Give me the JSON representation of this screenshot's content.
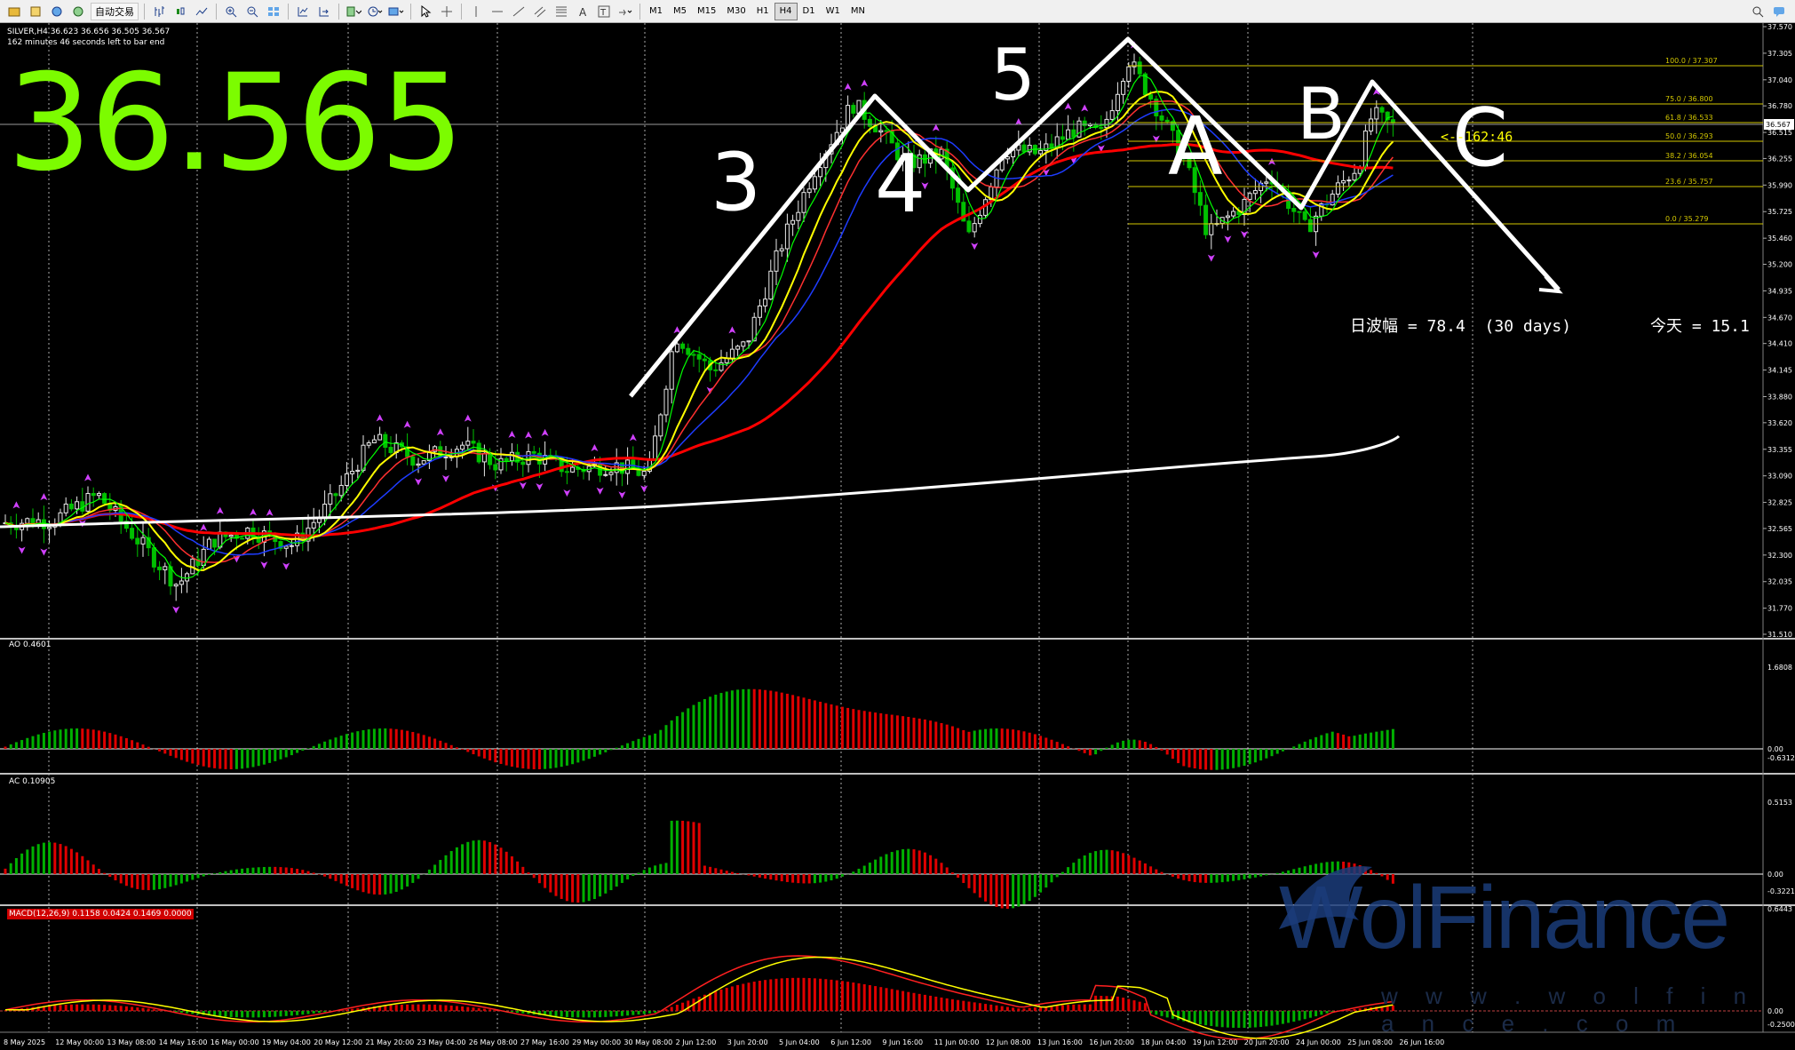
{
  "toolbar": {
    "auto_trade_label": "自动交易",
    "timeframes": [
      "M1",
      "M5",
      "M15",
      "M30",
      "H1",
      "H4",
      "D1",
      "W1",
      "MN"
    ],
    "active_timeframe": "H4"
  },
  "chart": {
    "symbol_info": "SILVER,H4 36.623 36.656 36.505 36.567",
    "bar_countdown": "162 minutes 46 seconds left to bar end",
    "big_price": "36.565",
    "timer_label": "<--162:46",
    "range_text": "日波幅 = 78.4  (30 days)",
    "today_text": "今天 = 15.1",
    "wave_labels": [
      "3",
      "4",
      "5",
      "A",
      "B",
      "C"
    ],
    "price_axis": [
      "37.570",
      "37.305",
      "37.040",
      "36.780",
      "36.515",
      "36.255",
      "35.990",
      "35.725",
      "35.460",
      "35.200",
      "34.935",
      "34.670",
      "34.410",
      "34.145",
      "33.880",
      "33.620",
      "33.355",
      "33.090",
      "32.825",
      "32.565",
      "32.300",
      "32.035",
      "31.770",
      "31.510"
    ],
    "current_price_tag": "36.567",
    "fib_levels": [
      {
        "label": "100.0 / 37.307"
      },
      {
        "label": "75.0 / 36.800"
      },
      {
        "label": "61.8 / 36.533"
      },
      {
        "label": "50.0 / 36.293"
      },
      {
        "label": "38.2 / 36.054"
      },
      {
        "label": "23.6 / 35.757"
      },
      {
        "label": "0.0 / 35.279"
      }
    ],
    "time_axis": [
      "8 May 2025",
      "12 May 00:00",
      "13 May 08:00",
      "14 May 16:00",
      "16 May 00:00",
      "19 May 04:00",
      "20 May 12:00",
      "21 May 20:00",
      "23 May 04:00",
      "26 May 08:00",
      "27 May 16:00",
      "29 May 00:00",
      "30 May 08:00",
      "2 Jun 12:00",
      "3 Jun 20:00",
      "5 Jun 04:00",
      "6 Jun 12:00",
      "9 Jun 16:00",
      "11 Jun 00:00",
      "12 Jun 08:00",
      "13 Jun 16:00",
      "16 Jun 20:00",
      "18 Jun 04:00",
      "19 Jun 12:00",
      "20 Jun 20:00",
      "24 Jun 00:00",
      "25 Jun 08:00",
      "26 Jun 16:00"
    ]
  },
  "indicators": {
    "ao": {
      "label": "AO 0.4601",
      "max": "1.6808",
      "zero": "0.00",
      "min": "-0.6312"
    },
    "ac": {
      "label": "AC 0.10905",
      "max": "0.5153",
      "zero": "0.00",
      "min": "-0.3221"
    },
    "macd": {
      "label": "MACD(12,26,9) 0.1158 0.0424 0.1469 0.0000",
      "max": "0.6443",
      "zero": "0.00",
      "min": "-0.2500"
    }
  },
  "watermark": {
    "brand": "WolFinance",
    "url": "w w w . w o l f i n a n c e . c o m"
  },
  "colors": {
    "bull": "#00b000",
    "bear": "#e00000",
    "ma_red": "#ff0000",
    "ma_yellow": "#ffff00",
    "ma_green": "#00ff00",
    "ma_blue": "#1e3cff",
    "big_price": "#7CFC00",
    "fib": "#d4c800"
  }
}
